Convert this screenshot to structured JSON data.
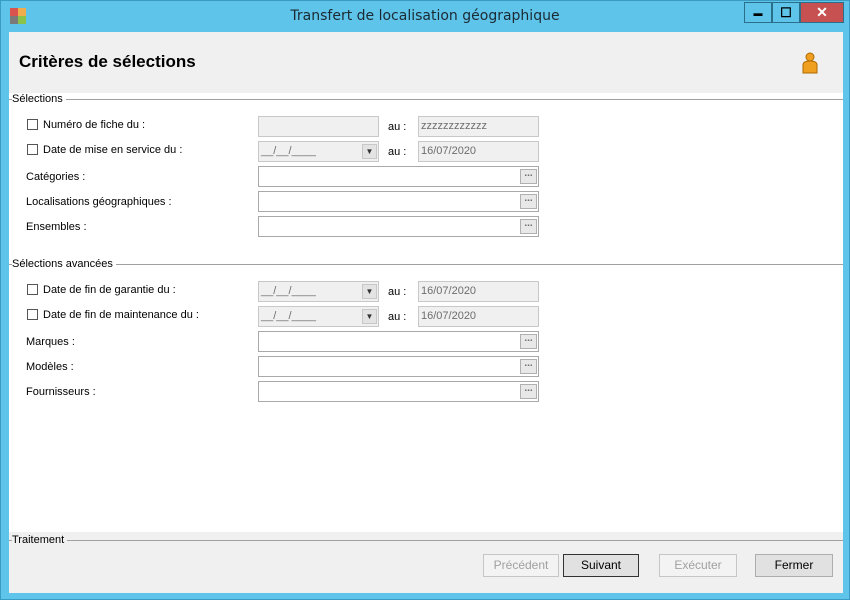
{
  "window": {
    "title": "Transfert de localisation géographique",
    "minimize_glyph": "▬",
    "maximize_glyph": "☐",
    "close_glyph": "✕",
    "icons": {
      "app": "app-icon",
      "user": "user-icon"
    }
  },
  "header": {
    "title": "Critères de sélections"
  },
  "selections": {
    "legend": "Sélections",
    "au": "au :",
    "fiche": {
      "label": "Numéro de fiche du :",
      "from": "",
      "to": "zzzzzzzzzzzz"
    },
    "mise_service": {
      "label": "Date de mise en service du :",
      "from": "__/__/____",
      "to": "16/07/2020"
    },
    "categories": {
      "label": "Catégories :",
      "value": ""
    },
    "localisations": {
      "label": "Localisations géographiques :",
      "value": ""
    },
    "ensembles": {
      "label": "Ensembles :",
      "value": ""
    }
  },
  "avancees": {
    "legend": "Sélections avancées",
    "garantie": {
      "label": "Date de fin de garantie du :",
      "from": "__/__/____",
      "to": "16/07/2020"
    },
    "maintenance": {
      "label": "Date de fin de maintenance du :",
      "from": "__/__/____",
      "to": "16/07/2020"
    },
    "marques": {
      "label": "Marques :",
      "value": ""
    },
    "modeles": {
      "label": "Modèles :",
      "value": ""
    },
    "fournisseurs": {
      "label": "Fournisseurs :",
      "value": ""
    }
  },
  "traitement": {
    "legend": "Traitement",
    "precedent": "Précédent",
    "suivant": "Suivant",
    "executer": "Exécuter",
    "fermer": "Fermer"
  },
  "browse_glyph": "...",
  "dropdown_glyph": "▼",
  "colors": {
    "titlebar": "#5fc4ea",
    "close": "#c75050",
    "header": "#f0f0f0"
  }
}
